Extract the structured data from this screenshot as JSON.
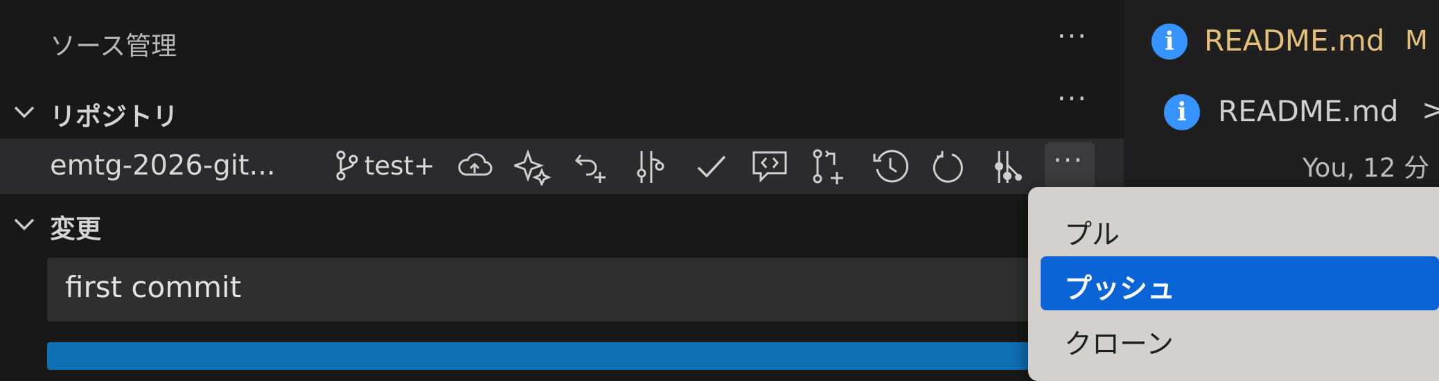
{
  "scm": {
    "title": "ソース管理",
    "more": "···",
    "sections": {
      "repositories": "リポジトリ",
      "changes": "変更"
    },
    "repo": {
      "name": "emtg-2026-git...",
      "branch": "test+"
    },
    "toolbar_icons": [
      "branch-icon",
      "cloud-upload-icon",
      "sparkle-icon",
      "undo-add-icon",
      "compare-icon",
      "commit-check-icon",
      "comment-code-icon",
      "pull-request-icon",
      "history-icon",
      "refresh-icon",
      "graph-icon",
      "more-actions-icon"
    ],
    "commit_message": "first commit"
  },
  "editor": {
    "tab": {
      "label": "README.md",
      "badge": "M"
    },
    "breadcrumb": {
      "file": "README.md",
      "sep": ">"
    },
    "blame": "You, 12 分"
  },
  "menu": {
    "items": [
      {
        "label": "プル",
        "selected": false
      },
      {
        "label": "プッシュ",
        "selected": true
      },
      {
        "label": "クローン",
        "selected": false
      }
    ]
  },
  "colors": {
    "background": "#181818",
    "repo_row": "#2a2b2e",
    "accent": "#0b64d6",
    "modified": "#e5c07b",
    "info": "#3794ff"
  }
}
